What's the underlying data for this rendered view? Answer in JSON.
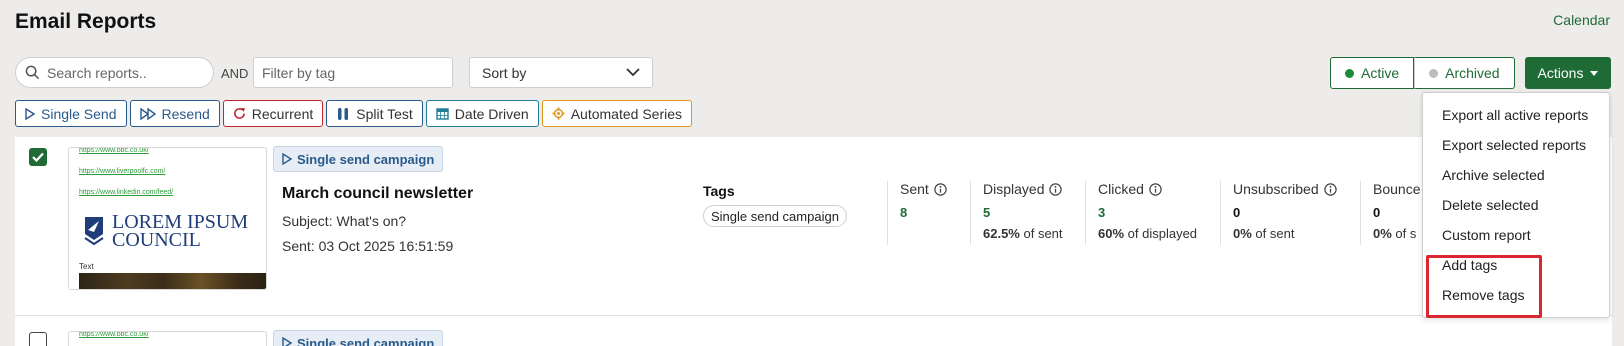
{
  "page": {
    "title": "Email Reports",
    "calendar_link": "Calendar"
  },
  "toolbar": {
    "search_placeholder": "Search reports..",
    "and_label": "AND",
    "tag_filter_placeholder": "Filter by tag",
    "sort_label": "Sort by",
    "status": {
      "active": "Active",
      "archived": "Archived"
    },
    "actions_label": "Actions"
  },
  "type_filters": [
    {
      "label": "Single Send",
      "icon": "play-outline-icon",
      "color": "#2b5a8c"
    },
    {
      "label": "Resend",
      "icon": "fast-forward-icon",
      "color": "#2b5a8c"
    },
    {
      "label": "Recurrent",
      "icon": "refresh-icon",
      "color": "#c0272d"
    },
    {
      "label": "Split Test",
      "icon": "test-tubes-icon",
      "color": "#2b5a8c"
    },
    {
      "label": "Date Driven",
      "icon": "calendar-icon",
      "color": "#1f7f95"
    },
    {
      "label": "Automated Series",
      "icon": "gear-icon",
      "color": "#e0961a"
    }
  ],
  "actions_menu": [
    "Export all active reports",
    "Export selected reports",
    "Archive selected",
    "Delete selected",
    "Custom report",
    "Add tags",
    "Remove tags"
  ],
  "reports": [
    {
      "checked": true,
      "badge": "Single send campaign",
      "thumbnail": {
        "links": [
          "https://www.bbc.co.uk/",
          "https://www.liverpoolfc.com/",
          "https://www.linkedin.com/feed/"
        ],
        "logo_text": [
          "LOREM IPSUM",
          "COUNCIL"
        ],
        "body_text": "Text"
      },
      "name": "March council newsletter",
      "subject": "Subject: What's on?",
      "sent": "Sent: 03 Oct 2025 16:51:59",
      "tags_heading": "Tags",
      "tags": [
        "Single send campaign"
      ],
      "stats": {
        "sent": {
          "label": "Sent",
          "value": "8"
        },
        "displayed": {
          "label": "Displayed",
          "value": "5",
          "pct": "62.5%",
          "suffix": " of sent"
        },
        "clicked": {
          "label": "Clicked",
          "value": "3",
          "pct": "60%",
          "suffix": " of displayed"
        },
        "unsubscribed": {
          "label": "Unsubscribed",
          "value": "0",
          "pct": "0%",
          "suffix": " of sent"
        },
        "bounced": {
          "label": "Bounce",
          "value": "0",
          "pct": "0%",
          "suffix": " of s"
        }
      }
    },
    {
      "checked": false,
      "badge": "Single send campaign",
      "thumbnail": {
        "links": [
          "https://www.bbc.co.uk/"
        ]
      }
    }
  ],
  "colors": {
    "accent": "#1e6b35",
    "highlight": "#d9262f",
    "active_dot": "#1e8a3a",
    "archived_dot": "#bdbdbd"
  }
}
